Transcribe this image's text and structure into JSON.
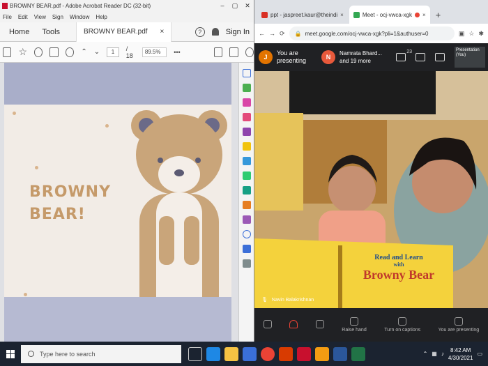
{
  "acrobat": {
    "window_title": "BROWNY BEAR.pdf - Adobe Acrobat Reader DC (32-bit)",
    "menu": [
      "File",
      "Edit",
      "View",
      "Sign",
      "Window",
      "Help"
    ],
    "tabs": {
      "home": "Home",
      "tools": "Tools",
      "document": "BROWNY BEAR.pdf",
      "close": "×"
    },
    "sign_in": "Sign In",
    "help": "?",
    "page_current": "1",
    "page_total": "/ 18",
    "zoom": "89.5%",
    "more": "•••",
    "cover_title_line1": "BROWNY",
    "cover_title_line2": "BEAR!"
  },
  "chrome": {
    "tabs": [
      {
        "label": "ppt - jaspreet.kaur@theindi",
        "close": "×",
        "favicon_color": "#d93025"
      },
      {
        "label": "Meet - ocj-vwca-xgk",
        "close": "×",
        "favicon_color": "#34a853"
      }
    ],
    "new_tab": "+",
    "url": "meet.google.com/ocj-vwca-xgk?pli=1&authuser=0"
  },
  "meet": {
    "presenter_avatar": "J",
    "presenter_text_line1": "You are",
    "presenter_text_line2": "presenting",
    "participant_avatar": "N",
    "participant_text_line1": "Namrata Bhard...",
    "participant_text_line2": "and 19 more",
    "participant_count": "23",
    "presentation_label_line1": "Presentation",
    "presentation_label_line2": "(You)",
    "video_name": "Navin Balakrishnan",
    "book_title_line1": "Read and Learn",
    "book_title_line2": "with",
    "book_title_line3": "Browny Bear",
    "controls": [
      "",
      "",
      "",
      "Raise hand",
      "Turn on captions",
      "You are presenting"
    ]
  },
  "taskbar": {
    "search_placeholder": "Type here to search",
    "time": "8:42 AM",
    "date": "4/30/2021"
  },
  "colors": {
    "acrobat_red": "#c8102e",
    "meet_dark": "#202124",
    "cover_title": "#c59a6a",
    "book_yellow": "#f4d23c",
    "book_red_text": "#c0392b"
  }
}
